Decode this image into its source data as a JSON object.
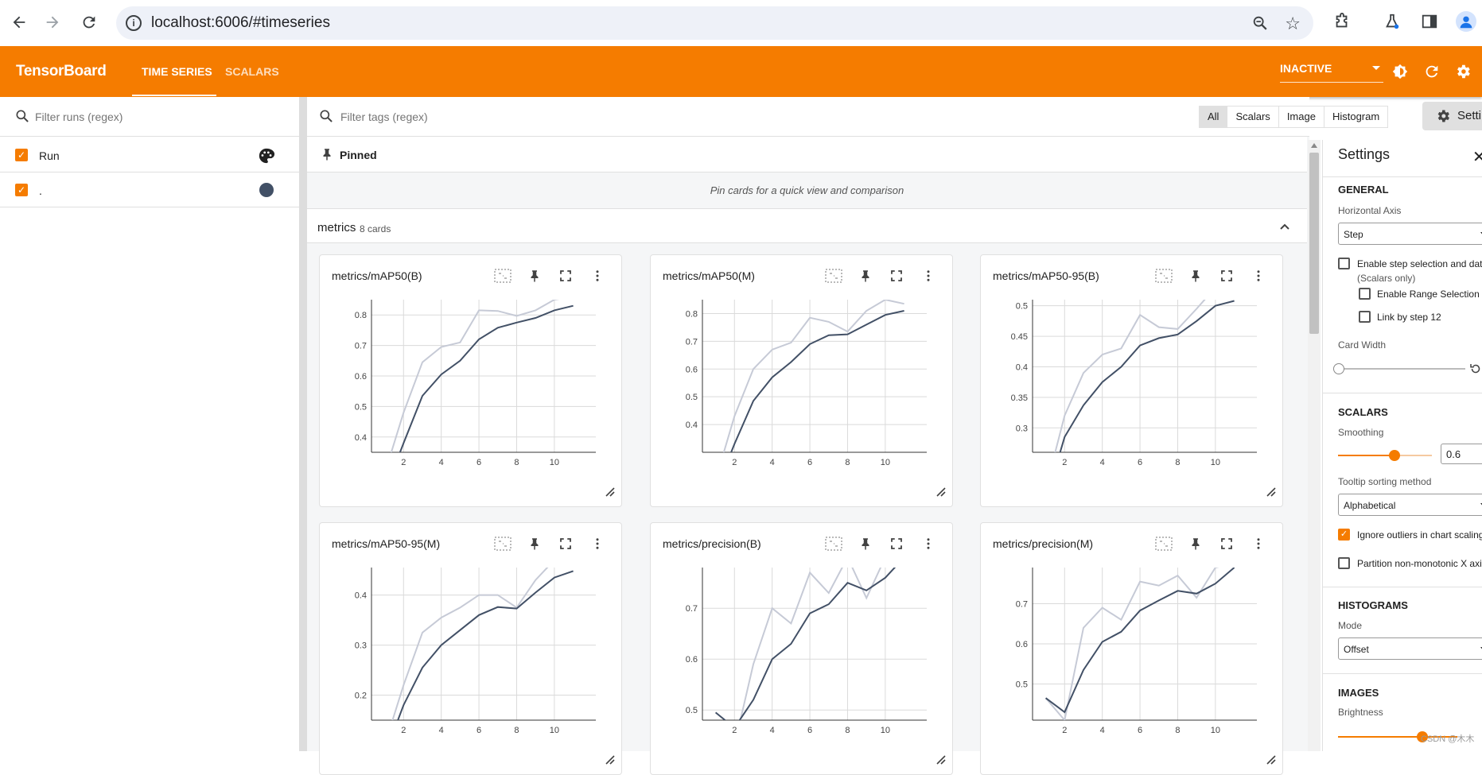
{
  "browser": {
    "url": "localhost:6006/#timeseries"
  },
  "toolbar": {
    "logo": "TensorBoard",
    "tabs": [
      {
        "label": "TIME SERIES",
        "active": true
      },
      {
        "label": "SCALARS",
        "active": false
      }
    ],
    "status_select": "INACTIVE",
    "accent_color": "#f57c00"
  },
  "sidebar": {
    "filter_placeholder": "Filter runs (regex)",
    "runs": [
      {
        "label": "Run",
        "checked": true,
        "icon": "palette-icon"
      },
      {
        "label": ".",
        "checked": true,
        "color": "#425066"
      }
    ]
  },
  "main": {
    "tag_filter_placeholder": "Filter tags (regex)",
    "type_filters": [
      "All",
      "Scalars",
      "Image",
      "Histogram"
    ],
    "active_type_filter": "All",
    "pinned": {
      "title": "Pinned",
      "empty_message": "Pin cards for a quick view and comparison"
    },
    "group": {
      "name": "metrics",
      "count_label": "8 cards"
    }
  },
  "settings_button": {
    "label": "Settings"
  },
  "settings": {
    "title": "Settings",
    "general": {
      "heading": "GENERAL",
      "horizontal_axis_label": "Horizontal Axis",
      "horizontal_axis_value": "Step",
      "step_selection_label": "Enable step selection and data table",
      "step_selection_sub": "(Scalars only)",
      "range_selection_label": "Enable Range Selection",
      "link_by_step_label": "Link by step 12",
      "card_width_label": "Card Width"
    },
    "scalars": {
      "heading": "SCALARS",
      "smoothing_label": "Smoothing",
      "smoothing_value": "0.6",
      "smoothing_fraction": 0.6,
      "tooltip_label": "Tooltip sorting method",
      "tooltip_value": "Alphabetical",
      "ignore_outliers_label": "Ignore outliers in chart scaling",
      "ignore_outliers_checked": true,
      "partition_label": "Partition non-monotonic X axis",
      "partition_checked": false
    },
    "histograms": {
      "heading": "HISTOGRAMS",
      "mode_label": "Mode",
      "mode_value": "Offset"
    },
    "images": {
      "heading": "IMAGES",
      "brightness_label": "Brightness"
    }
  },
  "watermark": "CSDN @木木",
  "chart_data": [
    {
      "type": "line",
      "title": "metrics/mAP50(B)",
      "xlim": [
        0.3,
        12.2
      ],
      "ylim": [
        0.35,
        0.85
      ],
      "xticks": [
        2,
        4,
        6,
        8,
        10
      ],
      "yticks": [
        0.4,
        0.5,
        0.6,
        0.7,
        0.8
      ],
      "ytick_labels": [
        "0.4",
        "0.5",
        "0.6",
        "0.7",
        "0.8"
      ],
      "x": [
        1,
        2,
        3,
        4,
        5,
        6,
        7,
        8,
        9,
        10,
        11
      ],
      "series": [
        {
          "role": "raw",
          "values": [
            0.28,
            0.48,
            0.645,
            0.695,
            0.71,
            0.815,
            0.813,
            0.797,
            0.815,
            0.85,
            0.86
          ]
        },
        {
          "role": "smoothed",
          "values": [
            0.22,
            0.38,
            0.535,
            0.605,
            0.65,
            0.72,
            0.758,
            0.775,
            0.79,
            0.815,
            0.83
          ]
        }
      ]
    },
    {
      "type": "line",
      "title": "metrics/mAP50(M)",
      "xlim": [
        0.3,
        12.2
      ],
      "ylim": [
        0.3,
        0.85
      ],
      "xticks": [
        2,
        4,
        6,
        8,
        10
      ],
      "yticks": [
        0.4,
        0.5,
        0.6,
        0.7,
        0.8
      ],
      "ytick_labels": [
        "0.4",
        "0.5",
        "0.6",
        "0.7",
        "0.8"
      ],
      "x": [
        1,
        2,
        3,
        4,
        5,
        6,
        7,
        8,
        9,
        10,
        11
      ],
      "series": [
        {
          "role": "raw",
          "values": [
            0.2,
            0.43,
            0.6,
            0.67,
            0.695,
            0.785,
            0.77,
            0.735,
            0.81,
            0.85,
            0.835
          ]
        },
        {
          "role": "smoothed",
          "values": [
            0.16,
            0.33,
            0.485,
            0.57,
            0.625,
            0.69,
            0.722,
            0.725,
            0.76,
            0.795,
            0.81
          ]
        }
      ]
    },
    {
      "type": "line",
      "title": "metrics/mAP50-95(B)",
      "xlim": [
        0.3,
        12.2
      ],
      "ylim": [
        0.26,
        0.51
      ],
      "xticks": [
        2,
        4,
        6,
        8,
        10
      ],
      "yticks": [
        0.3,
        0.35,
        0.4,
        0.45,
        0.5
      ],
      "ytick_labels": [
        "0.3",
        "0.35",
        "0.4",
        "0.45",
        "0.5"
      ],
      "x": [
        1,
        2,
        3,
        4,
        5,
        6,
        7,
        8,
        9,
        10,
        11
      ],
      "series": [
        {
          "role": "raw",
          "values": [
            0.2,
            0.32,
            0.39,
            0.42,
            0.43,
            0.485,
            0.465,
            0.462,
            0.495,
            0.53,
            0.54
          ]
        },
        {
          "role": "smoothed",
          "values": [
            0.18,
            0.285,
            0.337,
            0.375,
            0.4,
            0.435,
            0.447,
            0.453,
            0.475,
            0.5,
            0.508
          ]
        }
      ]
    },
    {
      "type": "line",
      "title": "metrics/mAP50-95(M)",
      "xlim": [
        0.3,
        12.2
      ],
      "ylim": [
        0.15,
        0.455
      ],
      "xticks": [
        2,
        4,
        6,
        8,
        10
      ],
      "yticks": [
        0.2,
        0.3,
        0.4
      ],
      "ytick_labels": [
        "0.2",
        "0.3",
        "0.4"
      ],
      "x": [
        1,
        2,
        3,
        4,
        5,
        6,
        7,
        8,
        9,
        10,
        11
      ],
      "series": [
        {
          "role": "raw",
          "values": [
            0.1,
            0.22,
            0.325,
            0.355,
            0.375,
            0.4,
            0.4,
            0.375,
            0.43,
            0.47,
            0.48
          ]
        },
        {
          "role": "smoothed",
          "values": [
            0.08,
            0.18,
            0.255,
            0.3,
            0.33,
            0.36,
            0.376,
            0.373,
            0.405,
            0.435,
            0.448
          ]
        }
      ]
    },
    {
      "type": "line",
      "title": "metrics/precision(B)",
      "xlim": [
        0.3,
        12.2
      ],
      "ylim": [
        0.48,
        0.78
      ],
      "xticks": [
        2,
        4,
        6,
        8,
        10
      ],
      "yticks": [
        0.5,
        0.6,
        0.7
      ],
      "ytick_labels": [
        "0.5",
        "0.6",
        "0.7"
      ],
      "x": [
        1,
        2,
        3,
        4,
        5,
        6,
        7,
        8,
        9,
        10,
        11
      ],
      "series": [
        {
          "role": "raw",
          "values": [
            0.47,
            0.43,
            0.59,
            0.7,
            0.67,
            0.77,
            0.73,
            0.8,
            0.72,
            0.8,
            0.82
          ]
        },
        {
          "role": "smoothed",
          "values": [
            0.495,
            0.465,
            0.52,
            0.6,
            0.63,
            0.69,
            0.708,
            0.75,
            0.735,
            0.76,
            0.8
          ]
        }
      ]
    },
    {
      "type": "line",
      "title": "metrics/precision(M)",
      "xlim": [
        0.3,
        12.2
      ],
      "ylim": [
        0.41,
        0.79
      ],
      "xticks": [
        2,
        4,
        6,
        8,
        10
      ],
      "yticks": [
        0.5,
        0.6,
        0.7
      ],
      "ytick_labels": [
        "0.5",
        "0.6",
        "0.7"
      ],
      "x": [
        1,
        2,
        3,
        4,
        5,
        6,
        7,
        8,
        9,
        10,
        11
      ],
      "series": [
        {
          "role": "raw",
          "values": [
            0.465,
            0.41,
            0.64,
            0.69,
            0.66,
            0.755,
            0.745,
            0.77,
            0.715,
            0.79,
            0.8
          ]
        },
        {
          "role": "smoothed",
          "values": [
            0.465,
            0.43,
            0.535,
            0.605,
            0.63,
            0.683,
            0.708,
            0.732,
            0.725,
            0.75,
            0.79
          ]
        }
      ]
    }
  ]
}
